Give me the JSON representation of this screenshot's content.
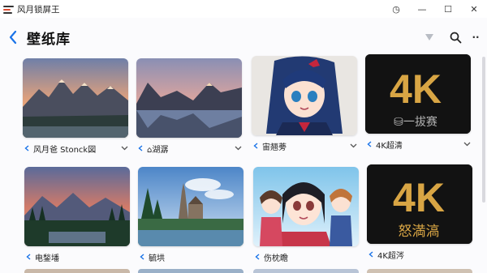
{
  "app": {
    "title": "风月锁屏王"
  },
  "window_controls": {
    "history": "◷",
    "minimize": "—",
    "maximize": "☐",
    "close": "✕"
  },
  "header": {
    "title": "壁纸库",
    "more": "··"
  },
  "wallpapers": [
    {
      "caption": "风月爸 Stonck図",
      "kind": "mountain-sunset"
    },
    {
      "caption": "⌂湖潺",
      "kind": "mountain-lake"
    },
    {
      "caption": "宙翘蒡",
      "kind": "anime-blue-hair"
    },
    {
      "caption": "4K超清",
      "kind": "4k-badge",
      "badge_top": "4K",
      "badge_sub": "⛁一拔赛"
    },
    {
      "caption": "电鍫墦",
      "kind": "mountain-forest"
    },
    {
      "caption": "毓垬",
      "kind": "castle-lake"
    },
    {
      "caption": "伤枕瞻",
      "kind": "anime-group"
    },
    {
      "caption": "4K超涔",
      "kind": "4k-badge",
      "badge_top": "4K",
      "badge_sub": "怒満滈"
    }
  ],
  "colors": {
    "accent": "#1a73e8",
    "gold": "#d8a544",
    "badge_bg": "#111111"
  }
}
